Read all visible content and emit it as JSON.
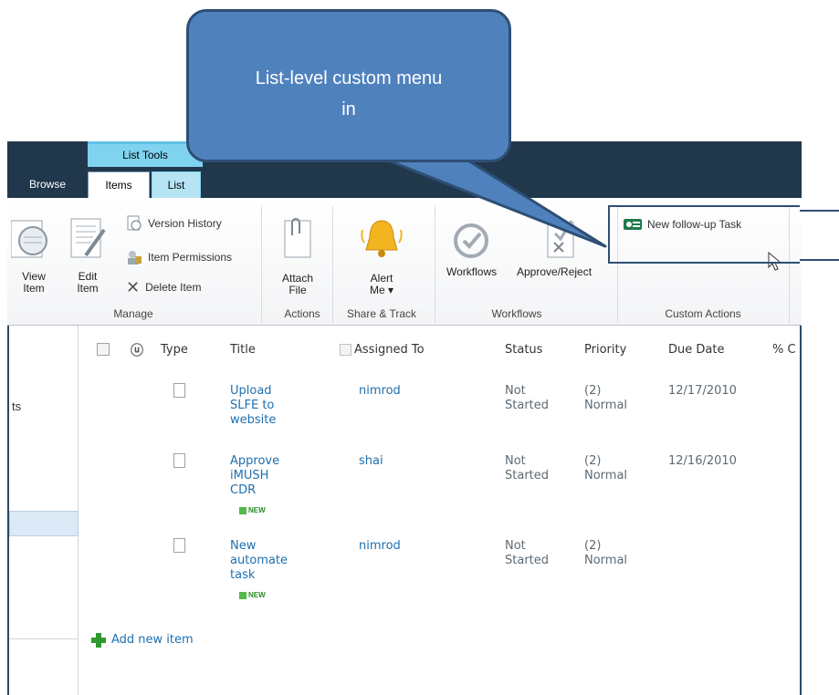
{
  "callout": {
    "line1": "List-level custom menu",
    "line2": "in"
  },
  "ribbon": {
    "context_label": "List Tools",
    "tabs": {
      "browse": "Browse",
      "items": "Items",
      "list": "List"
    },
    "manage": {
      "view_item": [
        "View",
        "Item"
      ],
      "edit_item": [
        "Edit",
        "Item"
      ],
      "version_history": "Version History",
      "item_permissions": "Item Permissions",
      "delete_item": "Delete Item",
      "group_label": "Manage"
    },
    "actions": {
      "attach_file": [
        "Attach",
        "File"
      ],
      "group_label": "Actions"
    },
    "share_track": {
      "alert_me": [
        "Alert",
        "Me"
      ],
      "group_label": "Share & Track"
    },
    "workflows": {
      "workflows": "Workflows",
      "approve_reject": "Approve/Reject",
      "group_label": "Workflows"
    },
    "custom_actions": {
      "new_followup": "New follow-up Task",
      "group_label": "Custom Actions"
    }
  },
  "nav": {
    "partial_label": "ts"
  },
  "list": {
    "columns": {
      "type": "Type",
      "title": "Title",
      "assigned_to": "Assigned To",
      "status": "Status",
      "priority": "Priority",
      "due_date": "Due Date",
      "percent": "% C"
    },
    "rows": [
      {
        "title": [
          "Upload",
          "SLFE to",
          "website"
        ],
        "assigned_to": "nimrod",
        "status": [
          "Not",
          "Started"
        ],
        "priority": [
          "(2)",
          "Normal"
        ],
        "due_date": "12/17/2010",
        "is_new": false
      },
      {
        "title": [
          "Approve",
          "iMUSH",
          "CDR"
        ],
        "assigned_to": "shai",
        "status": [
          "Not",
          "Started"
        ],
        "priority": [
          "(2)",
          "Normal"
        ],
        "due_date": "12/16/2010",
        "is_new": true
      },
      {
        "title": [
          "New",
          "automate",
          "task"
        ],
        "assigned_to": "nimrod",
        "status": [
          "Not",
          "Started"
        ],
        "priority": [
          "(2)",
          "Normal"
        ],
        "due_date": "",
        "is_new": true
      }
    ],
    "new_tag": "NEW",
    "add_new_item": "Add new item"
  },
  "colors": {
    "ribbon_dark": "#21374c",
    "context_tab": "#7fd3ef",
    "link": "#1f6fae",
    "callout": "#4f81bd"
  }
}
